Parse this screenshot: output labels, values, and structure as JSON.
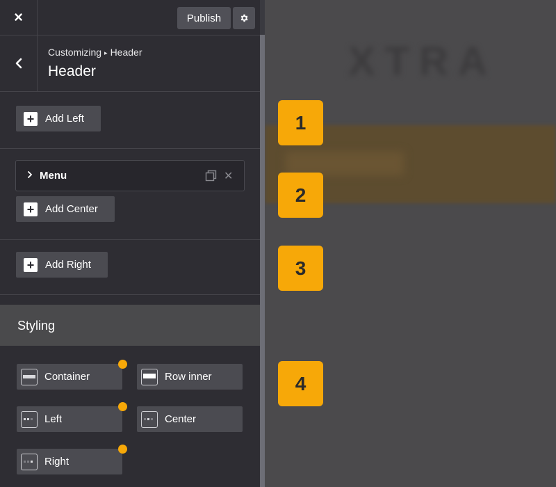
{
  "topbar": {
    "close_icon": "×",
    "publish_label": "Publish",
    "settings_icon": "gear-icon"
  },
  "titlebar": {
    "back_icon": "chevron-left-icon",
    "breadcrumb_root": "Customizing",
    "breadcrumb_sep": "▸",
    "breadcrumb_current": "Header",
    "title": "Header"
  },
  "sections": {
    "add_left": "Add Left",
    "menu_item": "Menu",
    "add_center": "Add Center",
    "add_right": "Add Right"
  },
  "styling": {
    "heading": "Styling",
    "buttons": [
      {
        "label": "Container",
        "modified": true
      },
      {
        "label": "Row inner",
        "modified": false
      },
      {
        "label": "Left",
        "modified": true
      },
      {
        "label": "Center",
        "modified": false
      },
      {
        "label": "Right",
        "modified": true
      }
    ]
  },
  "preview": {
    "logo_text": "XTRA"
  },
  "badges": [
    "1",
    "2",
    "3",
    "4"
  ],
  "colors": {
    "accent": "#f7a808",
    "panel_bg": "#2e2d33",
    "button_bg": "#4b4b51"
  }
}
